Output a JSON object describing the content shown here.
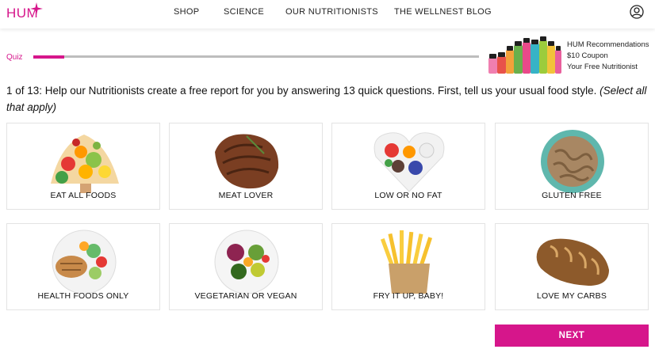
{
  "header": {
    "logo_text": "HUM",
    "nav": [
      "SHOP",
      "SCIENCE",
      "OUR NUTRITIONISTS",
      "THE WELLNEST BLOG"
    ],
    "account_icon": "user-circle-icon",
    "brand_color": "#d6168b"
  },
  "quiz": {
    "label": "Quiz",
    "progress": 0.07
  },
  "promo": {
    "lines": [
      "HUM Recommendations",
      "$10 Coupon",
      "Your Free Nutritionist"
    ]
  },
  "question": {
    "text": "1 of 13: Help our Nutritionists create a free report for you by answering 13 quick questions. First, tell us your usual food style. ",
    "hint": "(Select all that apply)"
  },
  "options": [
    {
      "label": "EAT ALL FOODS",
      "icon": "mixed-foods-image"
    },
    {
      "label": "MEAT LOVER",
      "icon": "steak-image"
    },
    {
      "label": "LOW OR NO FAT",
      "icon": "heart-bowl-image"
    },
    {
      "label": "GLUTEN FREE",
      "icon": "pasta-bowl-image"
    },
    {
      "label": "HEALTH FOODS ONLY",
      "icon": "chicken-salad-image"
    },
    {
      "label": "VEGETARIAN OR VEGAN",
      "icon": "veggie-plate-image"
    },
    {
      "label": "FRY IT UP, BABY!",
      "icon": "french-fries-image"
    },
    {
      "label": "LOVE MY CARBS",
      "icon": "bread-loaf-image"
    }
  ],
  "next_label": "NEXT"
}
